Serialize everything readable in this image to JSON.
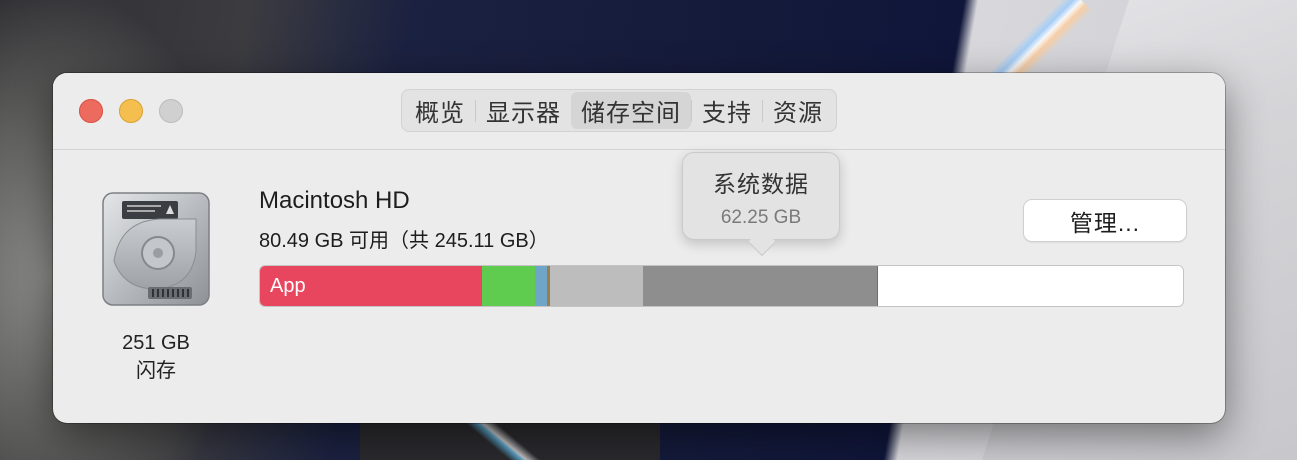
{
  "window": {
    "tabs": [
      {
        "label": "概览"
      },
      {
        "label": "显示器"
      },
      {
        "label": "储存空间",
        "active": true
      },
      {
        "label": "支持"
      },
      {
        "label": "资源"
      }
    ]
  },
  "disk": {
    "icon": "hard-drive-icon",
    "capacity": "251 GB",
    "type": "闪存"
  },
  "volume": {
    "name": "Macintosh HD",
    "available": "80.49 GB 可用（共 245.11 GB）"
  },
  "manage_button": {
    "label": "管理..."
  },
  "storage_bar": {
    "segments": [
      {
        "name": "app",
        "label": "App",
        "fraction": 0.24,
        "color": "#e8455f"
      },
      {
        "name": "green",
        "label": "",
        "fraction": 0.058,
        "color": "#5fcb4f"
      },
      {
        "name": "blue",
        "label": "",
        "fraction": 0.013,
        "color": "#6fa6c7"
      },
      {
        "name": "brown",
        "label": "",
        "fraction": 0.003,
        "color": "#9b7d50"
      },
      {
        "name": "other",
        "label": "",
        "fraction": 0.101,
        "color": "#bdbdbd"
      },
      {
        "name": "system-data",
        "label": "",
        "fraction": 0.255,
        "color": "#8e8e8e"
      },
      {
        "name": "free",
        "label": "",
        "fraction": 0.33,
        "color": "#ffffff"
      }
    ]
  },
  "tooltip": {
    "title": "系统数据",
    "value": "62.25 GB"
  },
  "colors": {
    "close": "#ed6a5e",
    "minimize": "#f5bf4f",
    "zoom": "#d0d0d0"
  }
}
